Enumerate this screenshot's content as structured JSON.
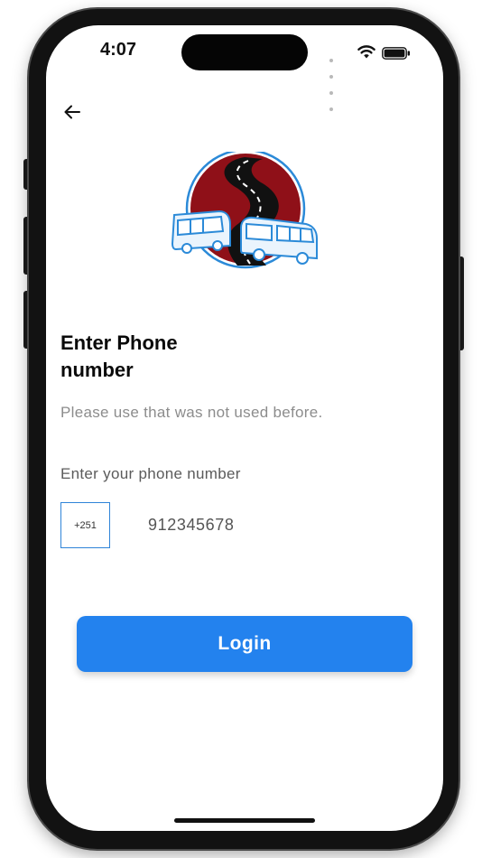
{
  "status_bar": {
    "time": "4:07",
    "icons": [
      "signal-dots-icon",
      "wifi-icon",
      "battery-icon"
    ]
  },
  "header": {
    "back_icon": "arrow-left-icon"
  },
  "logo": {
    "icon": "bus-road-logo",
    "colors": {
      "circle": "#8f1018",
      "ring": "#2b8ad8",
      "road": "#111111"
    }
  },
  "content": {
    "title": "Enter Phone number",
    "subtitle": "Please use that was not used before.",
    "field_label": "Enter your phone number",
    "country_code": "+251",
    "phone_number": "912345678"
  },
  "actions": {
    "login_label": "Login"
  },
  "colors": {
    "accent": "#2382ee",
    "input_border": "#2f84d8",
    "title": "#0a0a0a",
    "subtitle": "#8c8c8c"
  }
}
